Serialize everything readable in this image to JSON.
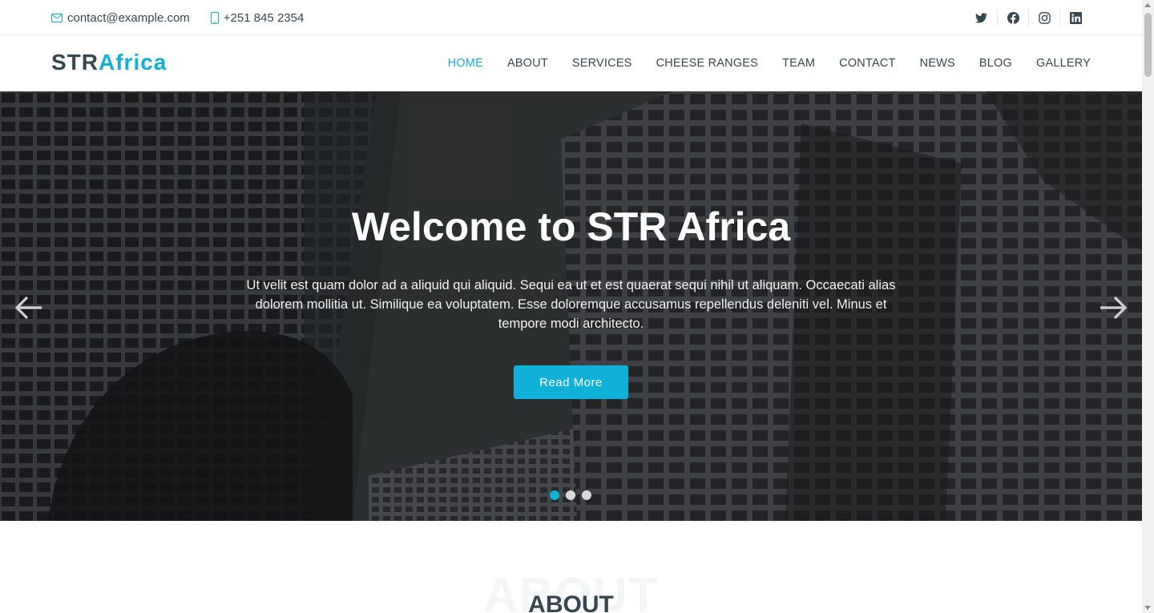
{
  "topbar": {
    "email": "contact@example.com",
    "phone": "+251 845 2354",
    "socials": [
      "twitter-icon",
      "facebook-icon",
      "instagram-icon",
      "linkedin-icon"
    ]
  },
  "header": {
    "logo_part1": "STR",
    "logo_part2": "Africa",
    "nav": [
      {
        "label": "HOME",
        "active": true
      },
      {
        "label": "ABOUT"
      },
      {
        "label": "SERVICES"
      },
      {
        "label": "CHEESE RANGES"
      },
      {
        "label": "TEAM"
      },
      {
        "label": "CONTACT"
      },
      {
        "label": "NEWS"
      },
      {
        "label": "BLOG"
      },
      {
        "label": "GALLERY"
      }
    ]
  },
  "hero": {
    "title": "Welcome to STR Africa",
    "text": "Ut velit est quam dolor ad a aliquid qui aliquid. Sequi ea ut et est quaerat sequi nihil ut aliquam. Occaecati alias dolorem mollitia ut. Similique ea voluptatem. Esse doloremque accusamus repellendus deleniti vel. Minus et tempore modi architecto.",
    "button": "Read More",
    "slides": 3,
    "active_slide": 1
  },
  "about": {
    "bg_text": "ABOUT",
    "title": "ABOUT"
  },
  "colors": {
    "accent": "#0fb1d8",
    "text": "#37474f"
  }
}
